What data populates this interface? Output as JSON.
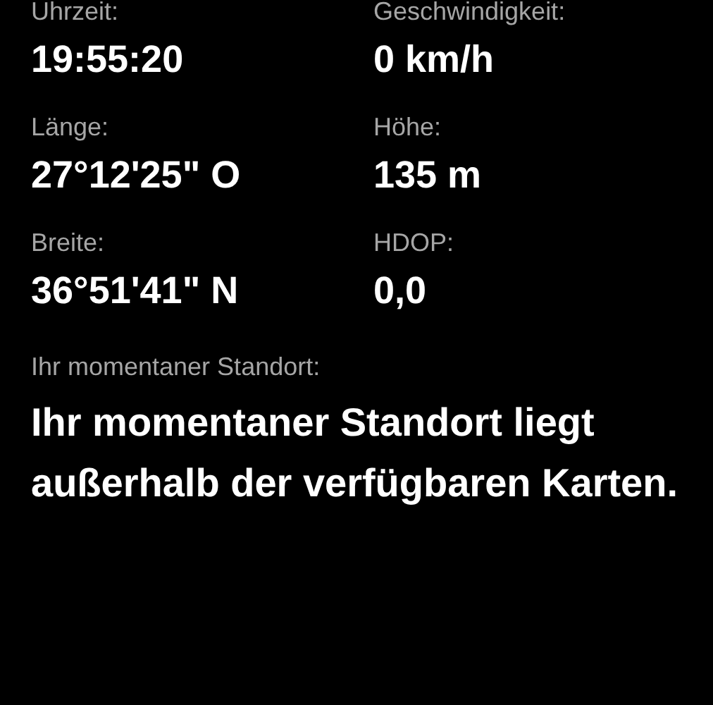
{
  "fields": [
    {
      "label": "Uhrzeit:",
      "value": "19:55:20"
    },
    {
      "label": "Geschwindigkeit:",
      "value": "0 km/h"
    },
    {
      "label": "Länge:",
      "value": "27°12'25\" O"
    },
    {
      "label": "Höhe:",
      "value": "135 m"
    },
    {
      "label": "Breite:",
      "value": "36°51'41\" N"
    },
    {
      "label": "HDOP:",
      "value": "0,0"
    }
  ],
  "location": {
    "label": "Ihr momentaner Standort:",
    "message": "Ihr momentaner Standort liegt außerhalb der verfügbaren Karten."
  }
}
